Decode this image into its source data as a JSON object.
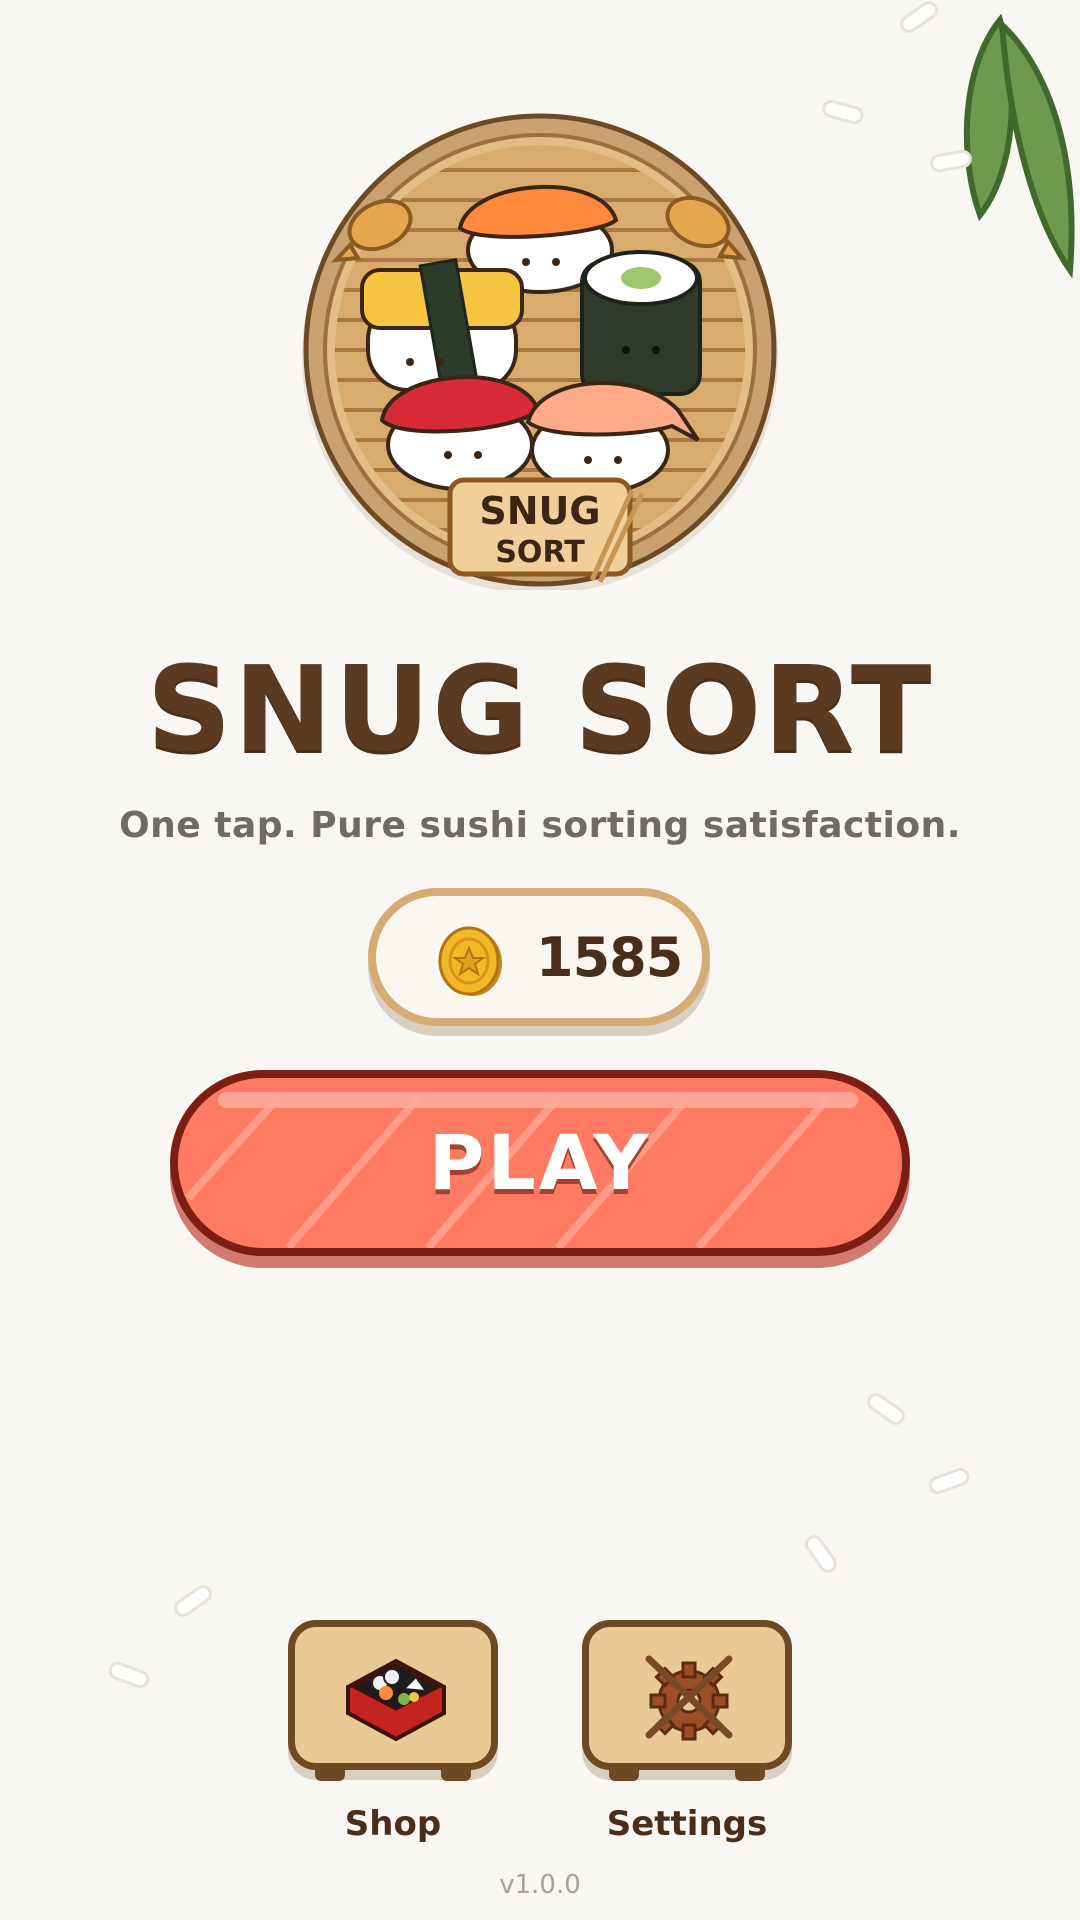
{
  "app": {
    "logo_text_line1": "SNUG",
    "logo_text_line2": "SORT",
    "title": "SNUG SORT",
    "tagline": "One tap. Pure sushi sorting satisfaction."
  },
  "coins": {
    "value": "1585",
    "icon": "coin-icon"
  },
  "play": {
    "label": "PLAY"
  },
  "nav": {
    "shop": {
      "label": "Shop",
      "icon": "bento-box-icon"
    },
    "settings": {
      "label": "Settings",
      "icon": "gear-chopsticks-icon"
    }
  },
  "footer": {
    "version": "v1.0.0"
  },
  "colors": {
    "background": "#f9f7f3",
    "title": "#5b3a22",
    "play_fill": "#ff7a62",
    "play_border": "#7c1f12",
    "coin_border": "#d6ac74",
    "tile_fill": "#e9c994",
    "leaf": "#6f9a4e"
  }
}
